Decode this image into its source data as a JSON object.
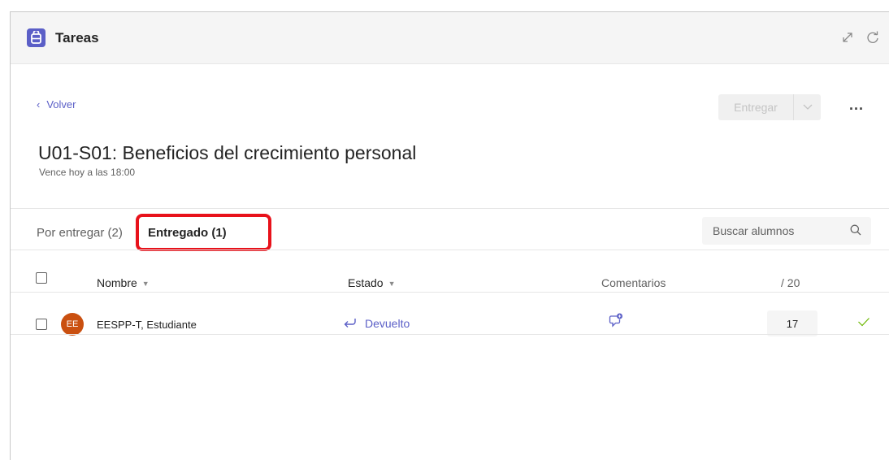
{
  "app": {
    "title": "Tareas",
    "icon": "assignments-icon"
  },
  "titlebar_actions": {
    "expand_icon": "expand-icon",
    "refresh_icon": "refresh-icon"
  },
  "nav": {
    "back_label": "Volver"
  },
  "actions": {
    "submit_label": "Entregar",
    "more_label": "..."
  },
  "assignment": {
    "title": "U01-S01: Beneficios del crecimiento personal",
    "due": "Vence hoy a las 18:00"
  },
  "tabs": [
    {
      "label": "Por entregar (2)",
      "selected": false
    },
    {
      "label": "Entregado (1)",
      "selected": true
    }
  ],
  "search": {
    "placeholder": "Buscar alumnos"
  },
  "table": {
    "headers": {
      "name": "Nombre",
      "status": "Estado",
      "comments": "Comentarios",
      "points": "/ 20"
    },
    "rows": [
      {
        "initials": "EE",
        "name": "EESPP-T, Estudiante",
        "status": "Devuelto",
        "grade": "17"
      }
    ]
  },
  "colors": {
    "accent": "#5b5fc7",
    "avatar": "#ca5010",
    "highlight": "#e8121b"
  }
}
